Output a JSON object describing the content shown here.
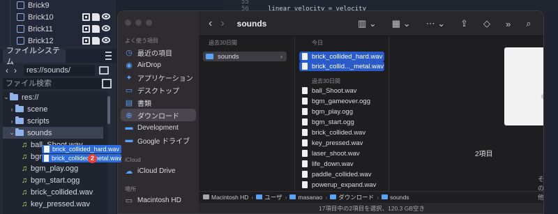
{
  "godot": {
    "scene_nodes": [
      {
        "label": "Brick9"
      },
      {
        "label": "Brick10"
      },
      {
        "label": "Brick11"
      },
      {
        "label": "Brick12"
      }
    ],
    "filesystem_tab": "ファイルシステム",
    "path": "res://sounds/",
    "search_placeholder": "ファイル検索",
    "tree": [
      {
        "label": "res://",
        "kind": "folder",
        "expanded": true
      },
      {
        "label": "scene",
        "kind": "folder",
        "expanded": false
      },
      {
        "label": "scripts",
        "kind": "folder",
        "expanded": false
      },
      {
        "label": "sounds",
        "kind": "folder",
        "expanded": true
      },
      {
        "label": "ball_Shoot.wav",
        "kind": "audio"
      },
      {
        "label": "bgm_",
        "kind": "audio"
      },
      {
        "label": "bgm_play.ogg",
        "kind": "audio"
      },
      {
        "label": "bgm_start.ogg",
        "kind": "audio"
      },
      {
        "label": "brick_collided.wav",
        "kind": "audio"
      },
      {
        "label": "key_pressed.wav",
        "kind": "audio"
      }
    ],
    "drag_items": [
      "brick_collided_hard.wav",
      "brick_collided_metal.wav"
    ],
    "drag_count": "2"
  },
  "code": {
    "line_numbers": [
      "55",
      "56"
    ],
    "line_text": "linear_velocity = velocity"
  },
  "finder": {
    "sidebar_sections": {
      "favorites": "よく使う項目",
      "icloud": "iCloud",
      "locations": "場所"
    },
    "favorites": [
      {
        "label": "最近の項目",
        "icon": "clock-icon"
      },
      {
        "label": "AirDrop",
        "icon": "airdrop-icon"
      },
      {
        "label": "アプリケーション",
        "icon": "apps-icon"
      },
      {
        "label": "デスクトップ",
        "icon": "desktop-icon"
      },
      {
        "label": "書類",
        "icon": "document-icon"
      },
      {
        "label": "ダウンロード",
        "icon": "download-icon"
      },
      {
        "label": "Development",
        "icon": "folder-icon"
      },
      {
        "label": "Google ドライブ",
        "icon": "folder-icon"
      }
    ],
    "icloud_items": [
      {
        "label": "iCloud Drive",
        "icon": "cloud-icon"
      }
    ],
    "location_items": [
      {
        "label": "Macintosh HD",
        "icon": "disk-icon"
      }
    ],
    "title": "sounds",
    "col1_header": "過去30日間",
    "col1_items": [
      {
        "label": "sounds"
      }
    ],
    "col2_header_today": "今日",
    "col2_today": [
      {
        "label": "brick_collided_hard.wav"
      },
      {
        "label": "brick_collid..._metal.wav"
      }
    ],
    "col2_header_past": "過去30日間",
    "col2_past": [
      {
        "label": "ball_Shoot.wav"
      },
      {
        "label": "bgm_gameover.ogg"
      },
      {
        "label": "bgm_play.ogg"
      },
      {
        "label": "bgm_start.ogg"
      },
      {
        "label": "brick_collided.wav"
      },
      {
        "label": "key_pressed.wav"
      },
      {
        "label": "laser_shoot.wav"
      },
      {
        "label": "life_down.wav"
      },
      {
        "label": "paddle_collided.wav"
      },
      {
        "label": "powerup_expand.wav"
      }
    ],
    "preview_count": "2項目",
    "more_label": "その他...",
    "path": [
      "Macintosh HD",
      "ユーザ",
      "masanao",
      "ダウンロード",
      "sounds"
    ],
    "status": "17項目中の2項目を選択、120.3 GB空き"
  }
}
